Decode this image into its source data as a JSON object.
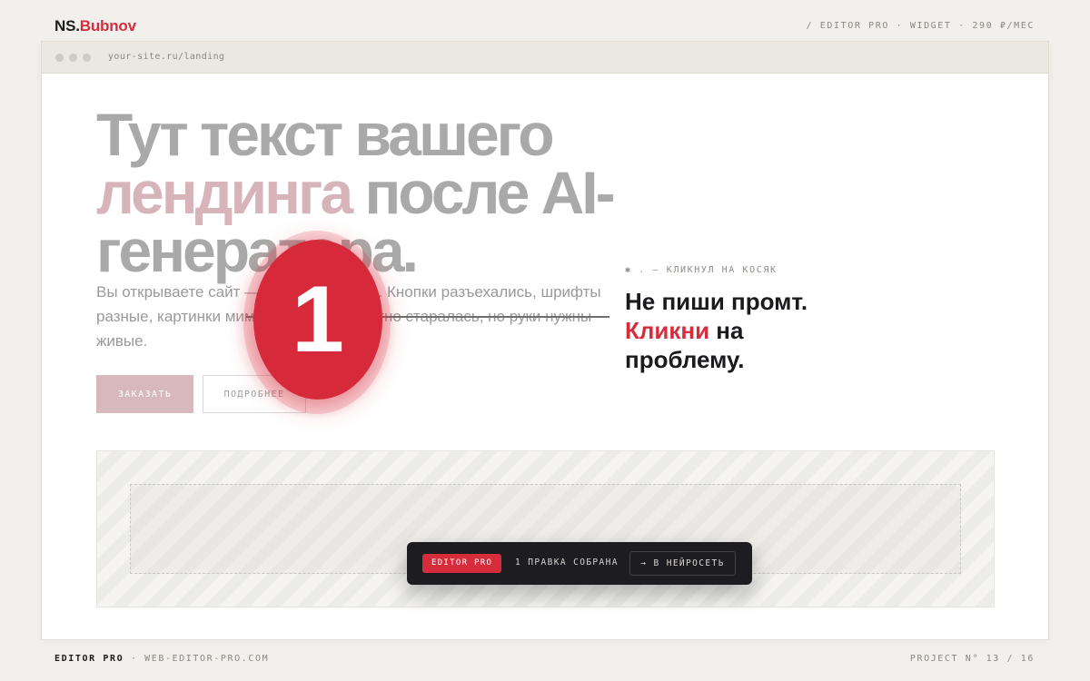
{
  "header": {
    "logo_prefix": "NS.",
    "logo_name": "Bubnov",
    "meta": "/ EDITOR PRO · WIDGET · 290 ₽/МЕС"
  },
  "browser": {
    "url": "your-site.ru/landing"
  },
  "hero": {
    "title_line1": "Тут текст вашего",
    "title_pink": "лендинга",
    "title_rest": " после AI-генератора.",
    "subtitle": "Вы открываете сайт — и видите косяки. Кнопки разъехались, шрифты разные, картинки мимо. Нейросеть честно старалась, но руки нужны живые.",
    "order_button": "ЗАКАЗАТЬ",
    "more_button": "ПОДРОБНЕЕ"
  },
  "marker": {
    "number": "1"
  },
  "note": {
    "kicker": "✱ . — КЛИКНУЛ НА КОСЯК",
    "line1": "Не пиши промт.",
    "red_word": "Кликни",
    "rest": " на проблему."
  },
  "toolbar": {
    "badge": "EDITOR PRO",
    "count": "1 ПРАВКА СОБРАНА",
    "send_button": "→ В НЕЙРОСЕТЬ"
  },
  "footer": {
    "brand": "EDITOR PRO",
    "site": " · WEB-EDITOR-PRO.COM",
    "project": "PROJECT N° 13 / 16"
  },
  "colors": {
    "accent": "#d62c3b",
    "background": "#f1f0ec",
    "toolbar_bg": "#1d1c20"
  }
}
